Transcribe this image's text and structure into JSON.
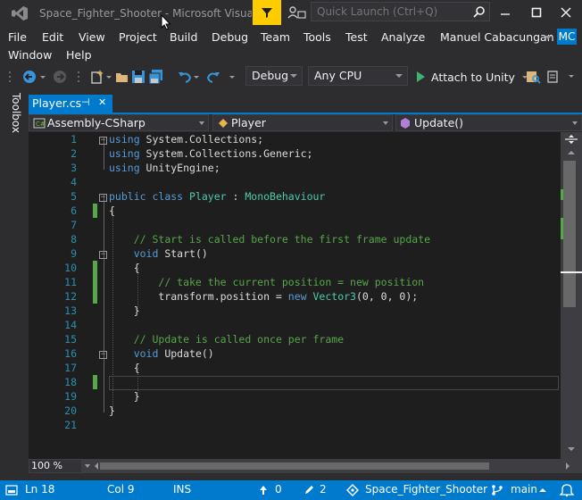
{
  "window": {
    "title": "Space_Fighter_Shooter - Microsoft Visual St...",
    "quick_launch_placeholder": "Quick Launch (Ctrl+Q)",
    "account_name": "Manuel Cabacungan",
    "avatar_initials": "MC"
  },
  "menu": {
    "items": [
      "File",
      "Edit",
      "View",
      "Project",
      "Build",
      "Debug",
      "Team",
      "Tools",
      "Test",
      "Analyze",
      "Window",
      "Help"
    ]
  },
  "toolbar": {
    "config": "Debug",
    "platform": "Any CPU",
    "attach_label": "Attach to Unity"
  },
  "toolbox": {
    "label": "Toolbox"
  },
  "tab": {
    "label": "Player.cs",
    "pin": "⊣",
    "close": "✕"
  },
  "navbar": {
    "project": "Assembly-CSharp",
    "type": "Player",
    "member": "Update()"
  },
  "code": {
    "line_numbers": [
      "1",
      "2",
      "3",
      "4",
      "5",
      "6",
      "7",
      "8",
      "9",
      "10",
      "11",
      "12",
      "13",
      "14",
      "15",
      "16",
      "17",
      "18",
      "19",
      "20",
      "21"
    ]
  },
  "editor": {
    "zoom": "100 %"
  },
  "status": {
    "line": "Ln 18",
    "col": "Col 9",
    "mode": "INS",
    "up_count": "0",
    "edits": "2",
    "repo": "Space_Fighter_Shooter",
    "branch": "main"
  },
  "colors": {
    "accent": "#007acc",
    "keyword": "#569cd6",
    "type": "#4ec9b0",
    "comment": "#57a64a",
    "feedback": "#ffcc00"
  }
}
